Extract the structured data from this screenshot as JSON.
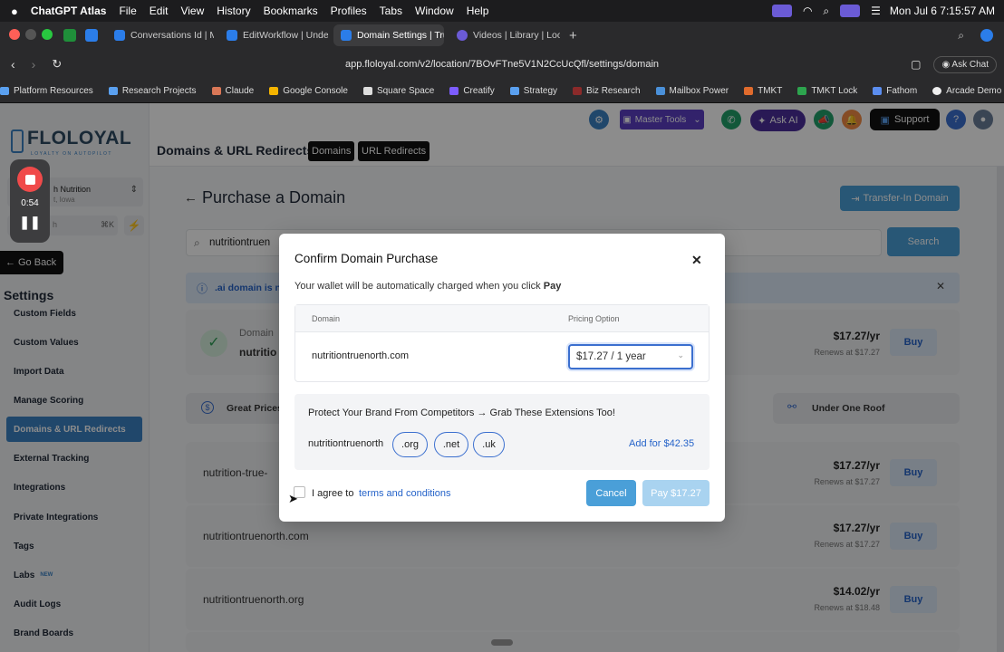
{
  "menubar": {
    "app": "ChatGPT Atlas",
    "items": [
      "File",
      "Edit",
      "View",
      "History",
      "Bookmarks",
      "Profiles",
      "Tabs",
      "Window",
      "Help"
    ],
    "clock": "Mon Jul 6  7:15:57 AM"
  },
  "tabs": [
    {
      "label": "Conversations Id | Mar"
    },
    {
      "label": "EditWorkflow | Undefin"
    },
    {
      "label": "Domain Settings | True"
    },
    {
      "label": "Videos | Library | Loom"
    }
  ],
  "address": {
    "url": "app.floloyal.com/v2/location/7BOvFTne5V1N2CcUcQfl/settings/domain",
    "ask_chat": "Ask Chat"
  },
  "bookmarks": [
    "Platform Resources",
    "Research Projects",
    "Claude",
    "Google Console",
    "Square Space",
    "Creatify",
    "Strategy",
    "Biz Research",
    "Mailbox Power",
    "TMKT",
    "TMKT Lock",
    "Fathom",
    "Arcade Demo SaaS"
  ],
  "logo": {
    "text": "FLOLOYAL",
    "tagline": "LOYALTY ON AUTOPILOT"
  },
  "recorder": {
    "time": "0:54"
  },
  "account": {
    "name": "h Nutrition",
    "location": "t, Iowa"
  },
  "search_shortcut": {
    "fragment": "h",
    "shortcut": "⌘K"
  },
  "go_back": "Go Back",
  "settings_title": "Settings",
  "nav": [
    "Custom Fields",
    "Custom Values",
    "Import Data",
    "Manage Scoring",
    "Domains & URL Redirects",
    "External Tracking",
    "Integrations",
    "Private Integrations",
    "Tags",
    "Labs",
    "Audit Logs",
    "Brand Boards"
  ],
  "labs_badge": "NEW",
  "header": {
    "title": "Domains & URL Redirects",
    "tab_domains": "Domains",
    "tab_redirects": "URL Redirects",
    "master_tools": "Master Tools",
    "ask_ai": "Ask AI",
    "support": "Support",
    "help": "?"
  },
  "page": {
    "title": "Purchase a Domain",
    "transfer_btn": "Transfer-In Domain",
    "search_value": "nutritiontruen",
    "search_btn": "Search",
    "banner": ".ai domain is n",
    "feature_left": "Great Prices",
    "feature_right": "Under One Roof"
  },
  "top_result": {
    "label": "Domain",
    "name": "nutritio",
    "price": "$17.27/yr",
    "renews": "Renews at $17.27",
    "buy": "Buy"
  },
  "results": [
    {
      "name": "nutrition-true-",
      "price": "$17.27/yr",
      "renews": "Renews at $17.27",
      "buy": "Buy"
    },
    {
      "name": "nutritiontruenorth.com",
      "price": "$17.27/yr",
      "renews": "Renews at $17.27",
      "buy": "Buy"
    },
    {
      "name": "nutritiontruenorth.org",
      "price": "$14.02/yr",
      "renews": "Renews at $18.48",
      "buy": "Buy"
    }
  ],
  "modal": {
    "title": "Confirm Domain Purchase",
    "note": "Your wallet will be automatically charged when you click",
    "note_strong": "Pay",
    "col_domain": "Domain",
    "col_pricing": "Pricing Option",
    "domain": "nutritiontruenorth.com",
    "pricing_selected": "$17.27 / 1 year",
    "protect_text": "Protect Your Brand From Competitors → Grab These Extensions Too!",
    "base_name": "nutritiontruenorth",
    "extensions": [
      ".org",
      ".net",
      ".uk"
    ],
    "add_for": "Add for $42.35",
    "agree": "I agree to",
    "terms": "terms and conditions",
    "cancel": "Cancel",
    "pay": "Pay $17.27"
  }
}
